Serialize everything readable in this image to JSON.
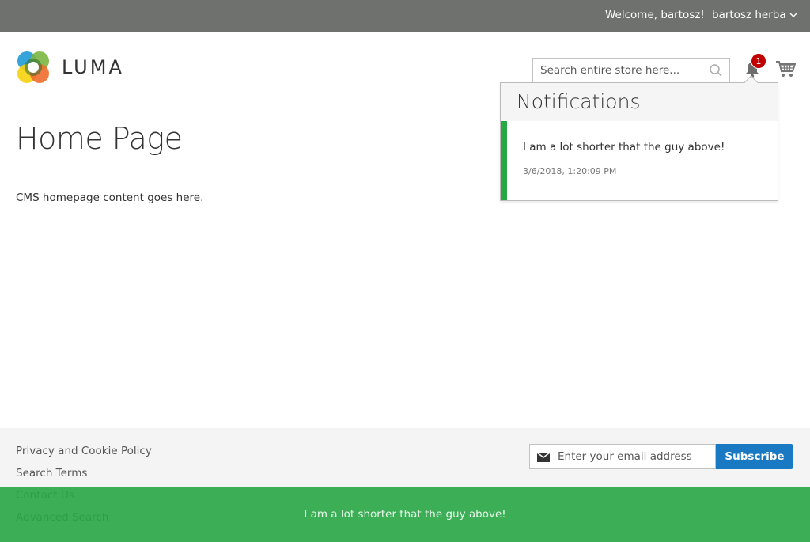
{
  "header_panel": {
    "welcome": "Welcome, bartosz!",
    "customer_name": "bartosz herba"
  },
  "logo": {
    "text": "LUMA"
  },
  "search": {
    "placeholder": "Search entire store here..."
  },
  "notifications": {
    "count": "1",
    "title": "Notifications",
    "items": [
      {
        "message": "I am a lot shorter that the guy above!",
        "time": "3/6/2018, 1:20:09 PM",
        "status_color": "#28a745"
      }
    ]
  },
  "main": {
    "page_title": "Home Page",
    "content": "CMS homepage content goes here."
  },
  "footer": {
    "links": [
      "Privacy and Cookie Policy",
      "Search Terms",
      "Contact Us",
      "Advanced Search"
    ],
    "newsletter": {
      "placeholder": "Enter your email address",
      "button": "Subscribe"
    }
  },
  "toast": {
    "message": "I am a lot shorter that the guy above!"
  },
  "colors": {
    "panel": "#6e716e",
    "accent": "#1979c3",
    "badge": "#c10000",
    "success": "#28a745"
  }
}
